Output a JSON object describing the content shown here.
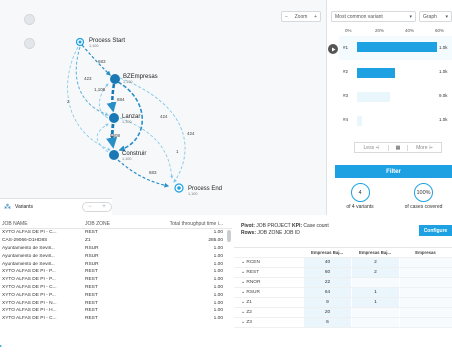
{
  "process_map": {
    "zoom_label": "Zoom",
    "nodes": [
      {
        "name": "Process Start",
        "count": "1,100"
      },
      {
        "name": "BZEmpresas",
        "count": "1,100"
      },
      {
        "name": "Lanzar",
        "count": "1,100"
      },
      {
        "name": "Construir",
        "count": "1,100"
      },
      {
        "name": "Process End",
        "count": "1,100"
      }
    ],
    "edge_labels": [
      "683",
      "423",
      "884",
      "1,108",
      "424",
      "2",
      "5508",
      "424",
      "1",
      "683"
    ],
    "variants_label": "Variants"
  },
  "variant_panel": {
    "sort_value": "Most common variant",
    "view_value": "Graph",
    "axis_ticks": [
      "0%",
      "20%",
      "40%",
      "60%"
    ],
    "rows": [
      {
        "label": "#1",
        "percent": 68,
        "value": "1.0k"
      },
      {
        "label": "#2",
        "percent": 32,
        "value": "1.0k"
      },
      {
        "label": "#3",
        "percent": 28,
        "value": "9.0k"
      },
      {
        "label": "#4",
        "percent": 4,
        "value": "1.0k"
      }
    ],
    "less_label": "Less",
    "more_label": "More",
    "filter_label": "Filter",
    "variants_count": "4",
    "variants_caption": "of 4 variants",
    "cases_percent": "100%",
    "cases_caption": "of cases covered",
    "accent_color": "#1da1e2"
  },
  "job_table": {
    "headers": [
      "JOB NAME",
      "JOB ZONE",
      "Total throughput time i..."
    ],
    "rows": [
      [
        "XYTO ALFAS DE PI - C...",
        "REST",
        "1.00"
      ],
      [
        "CAS-29066-D1HD8S",
        "Z1",
        "285.00"
      ],
      [
        "Ayuntamiento de Sevill...",
        "RSUR",
        "1.00"
      ],
      [
        "Ayuntamiento de Sevill...",
        "RSUR",
        "1.00"
      ],
      [
        "Ayuntamiento de Sevill...",
        "RSUR",
        "1.00"
      ],
      [
        "XYTO ALFAS DE PI - P...",
        "REST",
        "1.00"
      ],
      [
        "XYTO ALFAS DE PI - P...",
        "REST",
        "1.00"
      ],
      [
        "XYTO ALFAS DE PI - C...",
        "REST",
        "1.00"
      ],
      [
        "XYTO ALFAS DE PI - P...",
        "REST",
        "1.00"
      ],
      [
        "XYTO ALFAS DE PI - N...",
        "REST",
        "1.00"
      ],
      [
        "XYTO ALFAS DE PI - H...",
        "REST",
        "1.00"
      ],
      [
        "XYTO ALFAS DE PI - C...",
        "REST",
        "1.00"
      ]
    ]
  },
  "pivot": {
    "pivot_label": "Pivot:",
    "pivot_value": "JOB PROJECT",
    "kpi_label": "KPI:",
    "kpi_value": "Case count",
    "rows_label": "Rows:",
    "rows_value": "JOB ZONE  JOB ID",
    "configure_label": "Configure",
    "col_headers": [
      "Empresas Baj...",
      "Empresas Baj...",
      "Empresas"
    ],
    "rows": [
      {
        "label": "RCEN",
        "values": [
          "40",
          "2",
          ""
        ]
      },
      {
        "label": "REST",
        "values": [
          "60",
          "2",
          ""
        ]
      },
      {
        "label": "RNOR",
        "values": [
          "22",
          "",
          ""
        ]
      },
      {
        "label": "RSUR",
        "values": [
          "64",
          "1",
          ""
        ]
      },
      {
        "label": "Z1",
        "values": [
          "9",
          "1",
          ""
        ]
      },
      {
        "label": "Z2",
        "values": [
          "20",
          "",
          ""
        ]
      },
      {
        "label": "Z3",
        "values": [
          "6",
          "",
          ""
        ]
      }
    ]
  }
}
